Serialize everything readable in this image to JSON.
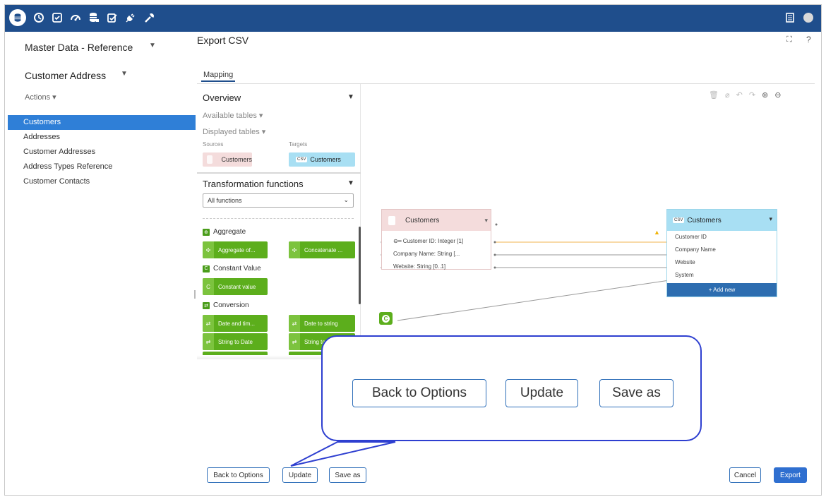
{
  "topbar": {
    "icons": [
      "database-icon",
      "clock-icon",
      "checklist-icon",
      "gauge-icon",
      "database-stack-icon",
      "edit-check-icon",
      "plug-icon",
      "wrench-icon"
    ],
    "right_icons": [
      "document-icon",
      "avatar"
    ]
  },
  "sidebar": {
    "model": "Master Data - Reference",
    "entity": "Customer Address",
    "actions": "Actions",
    "items": [
      {
        "label": "Customers",
        "active": true
      },
      {
        "label": "Addresses",
        "active": false
      },
      {
        "label": "Customer Addresses",
        "active": false
      },
      {
        "label": "Address Types Reference",
        "active": false
      },
      {
        "label": "Customer Contacts",
        "active": false
      }
    ]
  },
  "main": {
    "title": "Export CSV",
    "tab": "Mapping"
  },
  "overview": {
    "title": "Overview",
    "available_tables": "Available tables",
    "displayed_tables": "Displayed tables",
    "sources_label": "Sources",
    "targets_label": "Targets",
    "source_chip": "Customers",
    "target_chip": "Customers",
    "csv_badge": "CSV"
  },
  "transformations": {
    "title": "Transformation functions",
    "filter": "All functions",
    "categories": {
      "aggregate": {
        "label": "Aggregate",
        "badge": "⊕",
        "functions": [
          "Aggregate of...",
          "Concatenate ..."
        ]
      },
      "constant": {
        "label": "Constant Value",
        "badge": "C",
        "functions": [
          "Constant value"
        ]
      },
      "conversion": {
        "label": "Conversion",
        "badge": "⇄",
        "functions": [
          "Date and tim...",
          "Date to string",
          "String to Date",
          "String to D..."
        ]
      }
    }
  },
  "canvas": {
    "source_node": {
      "title": "Customers",
      "fields": [
        "Customer ID: Integer [1]",
        "Company Name: String [...",
        "Website: String [0..1]"
      ]
    },
    "target_node": {
      "title": "Customers",
      "csv_badge": "CSV",
      "fields": [
        "Customer ID",
        "Company Name",
        "Website",
        "System"
      ],
      "add_new": "+ Add new"
    },
    "constant_node": "C"
  },
  "callout": {
    "back": "Back to Options",
    "update": "Update",
    "save_as": "Save as"
  },
  "footer": {
    "back": "Back to Options",
    "update": "Update",
    "save_as": "Save as",
    "cancel": "Cancel",
    "export": "Export"
  },
  "colors": {
    "topbar": "#1f4e8c",
    "active_nav": "#2f7fd7",
    "source_node": "#f4dcdc",
    "target_node": "#a8dff3",
    "function": "#5cae1c",
    "callout_border": "#2e3fd0",
    "mapping_line_highlight": "#f0b450"
  }
}
